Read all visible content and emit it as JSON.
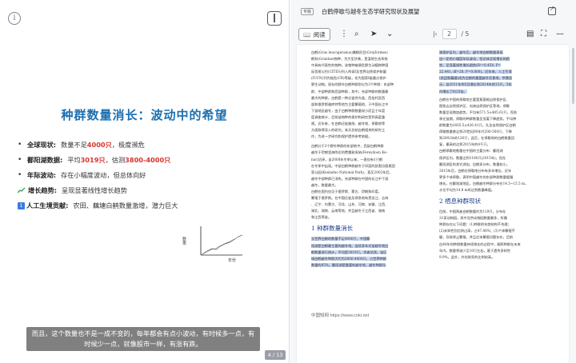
{
  "slide": {
    "title": "种群数量消长：波动中的希望",
    "bullets": [
      {
        "icon": "•",
        "key": "全球现状:",
        "pre": "数量不足",
        "red": "4000只",
        "post": "，极度濒危"
      },
      {
        "icon": "•",
        "key": "鄱阳湖数据:",
        "pre": "平均",
        "red": "3019只",
        "post": "，估测",
        "red2": "3800-4000只"
      },
      {
        "icon": "•",
        "key": "年际波动:",
        "pre": "存在小幅度波动，但总体向好",
        "red": "",
        "post": ""
      },
      {
        "icon": "trend",
        "key": "增长趋势:",
        "pre": "呈现显著线性增长趋势",
        "red": "",
        "post": ""
      },
      {
        "icon": "1",
        "key": "人工生境贡献:",
        "pre": "农田、藕塘白鹤数量激增，潜力巨大",
        "red": "",
        "post": ""
      }
    ],
    "mini_chart": {
      "ylabel": "数量",
      "xlabel": "年份"
    },
    "subtitle": "而且，这个数量也不是一成不变的，每年都会有点小波动，有时候多一点，有时候少一点，就像股市一样，有涨有跌。",
    "page_indicator": "4 / 13"
  },
  "reader": {
    "tab_badge": "专版",
    "doc_title": "白鹤停歇与越冬生态学研究现状及展望",
    "read_label": "阅读",
    "page_current": "2",
    "page_total": "/ 5",
    "left_col_top": [
      "白鹤(Grus leucogeranus)属鹤形目(Gruiformes)",
      "鹤科(Gruidae)物种，为大型涉禽，是湿地生态系统",
      "中具有代表性的物种。该物种被濒危野生动植物种国",
      "际贸易公约(CITES)列入附录Ⅰ及世界自然保护联盟",
      "(IUCN)列为极危(CR)等级，也为国家Ⅰ级重点保护",
      "野生动物。现存的野外白鹤种群划分为3个种群：东部种",
      "群、中部种群和西部种群，其中，东部种群的数量最",
      "最大的种群。白鹤是一种迁徙性鸟类，西伯利亚西",
      "部和俄罗斯雅库特等地为主要繁殖地，于中国长江中",
      "下游地区越冬，由于白鹤种群数量较小而且于年度",
      "度调查统计，目前该物种的保护和研究受到高度重",
      "视。近年来，在白鹤迁徙路线、越冬地、停歇地等",
      "方面取得深入的研究。本文总结白鹤相关的研究工",
      "作，为进一步研究和保护提供参考依据。"
    ],
    "left_col_mid": [
      "白鹤分于3个野外种群的东部地中，西部白鹤种群",
      "越冬于伊朗里海附近的费雷敦肯纳(Fereydoon Ke-",
      "nar)沼泽，自2008年冬季以来，一直仅有1只鹤",
      "在冬季中出现。中部白鹤种群越冬于印度的凯奥拉德奥国",
      "家公园(Keoladeo National Park)，直至2002年后，",
      "越冬中部种群已消失。东部种群在中国的长江中下游",
      "越冬，数量最大。",
      "白鹤在国内仅见于俄罗斯、蒙古、伊朗和印度，",
      "繁殖于俄罗斯。在中国迁徙及停息地有黑龙江、吉林",
      "、辽宁、内蒙古、河北、山东、河南、安徽、江西、",
      "湖北、湖南、云南等地，并且越冬于江西省、湖南",
      "和江西等省。"
    ],
    "left_section": "1  种群数量消长",
    "left_col_bottom": [
      "全世界白鹤的数量不足4000只，中国鄱",
      "阳湖是白鹤最主要的越冬地。连续多年对该越冬地白",
      "鹤数量进行统计，平均是3019只。学者估测，该区",
      "域白鹤越冬种群大约为3800-4000只，占世界种群",
      "数量的95%。鄱阳湖是重要的越冬地，越冬种群均"
    ],
    "right_col_top": [
      "湖保护区内，越冬后，越冬地白鹤数量表现",
      "出一定的小幅度年际波动，但总体呈现增长的趋",
      "势，呈显著线性增长趋势(R²=0.454, P=",
      "22.441, df=28, P=0.000)。近年来，人工生境",
      "(农田和藕塘)成为白鹤的重要越冬觅食地，供需显",
      "示，自2011年到5月增长到2014年的13只，5年",
      "内增长了约25倍。"
    ],
    "right_col_mid": [
      "白鹤在中国的停歇地主要是莫莫格自然保护区、",
      "图牧吉自然保护区、向海自然保护区等地，停歇",
      "数量呈现增加趋势，平均有571.5±485.61只，而秋",
      "季迁徙期，停歇的种群数量呈显著下降趋势。平均种",
      "群数量为1605.5±426.41只。扎龙自然保护区白鹤",
      "停歇数量曾达到20世纪80年代200-500只，下降",
      "到2002年的126只，此后，在停歇地的白鹤数量回",
      "复，最高的达到2015年的4千只。",
      "白鹤停歇地数量在中国的主要分布：鄱阳湖",
      "保护区内，数量达到1180只(2015年)，但在",
      "鄱阳湖区的其它湖泊，白鹤多分布，数量较小。",
      "2015年后，白鹤在停歇地分布有多年增长，近年",
      "更多个体停歇，表明中国越冬的东部种群数量缓慢",
      "增长。在鄱阳湖地区，白鹤越冬种群分布在14.5~15.5 m，",
      "水位平均为14.8 m时达到数量峰值。"
    ],
    "right_section": "2  栖息种群现状",
    "right_col_bottom": [
      "目前，中国两者白鹤数量约为119只，分布在",
      "31家动物园，其中北京动物园数量最多，所属",
      "种群存在以下问题：(1)种群的年龄结构不合理；",
      "(2)未知性别比例过高，占47.06%；(3)个体繁殖不",
      "健，导致停止繁殖，并且近亲繁殖问题存在，目前",
      "白40年的种群数量持续增长的过程中，圈养种群在未来",
      "年内，数量将减少至10只左右。基于遗传多样性",
      "9.9%，此外，外伤致死的比例较高。"
    ],
    "footer": "中国知网  https://www.cnki.net"
  },
  "colors": {
    "title_blue": "#1a6fb0",
    "accent_red": "#d9342b",
    "highlight": "#c8d8f4"
  }
}
